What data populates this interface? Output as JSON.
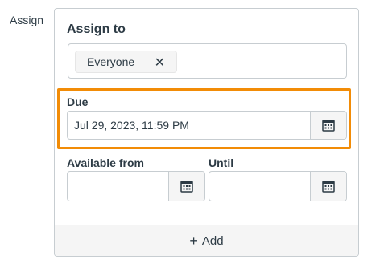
{
  "section_label": "Assign",
  "assign_to": {
    "title": "Assign to",
    "token": "Everyone",
    "token_remove_glyph": "✕"
  },
  "due": {
    "label": "Due",
    "value": "Jul 29, 2023, 11:59 PM"
  },
  "available_from": {
    "label": "Available from",
    "value": ""
  },
  "until": {
    "label": "Until",
    "value": ""
  },
  "add_button": {
    "label": "Add",
    "plus": "+"
  },
  "colors": {
    "highlight": "#f28c07",
    "text": "#2d3b45",
    "border": "#c7cdd1",
    "button_bg": "#f5f5f5"
  },
  "icons": {
    "calendar": "calendar-icon",
    "remove": "close-icon",
    "add": "plus-icon"
  }
}
